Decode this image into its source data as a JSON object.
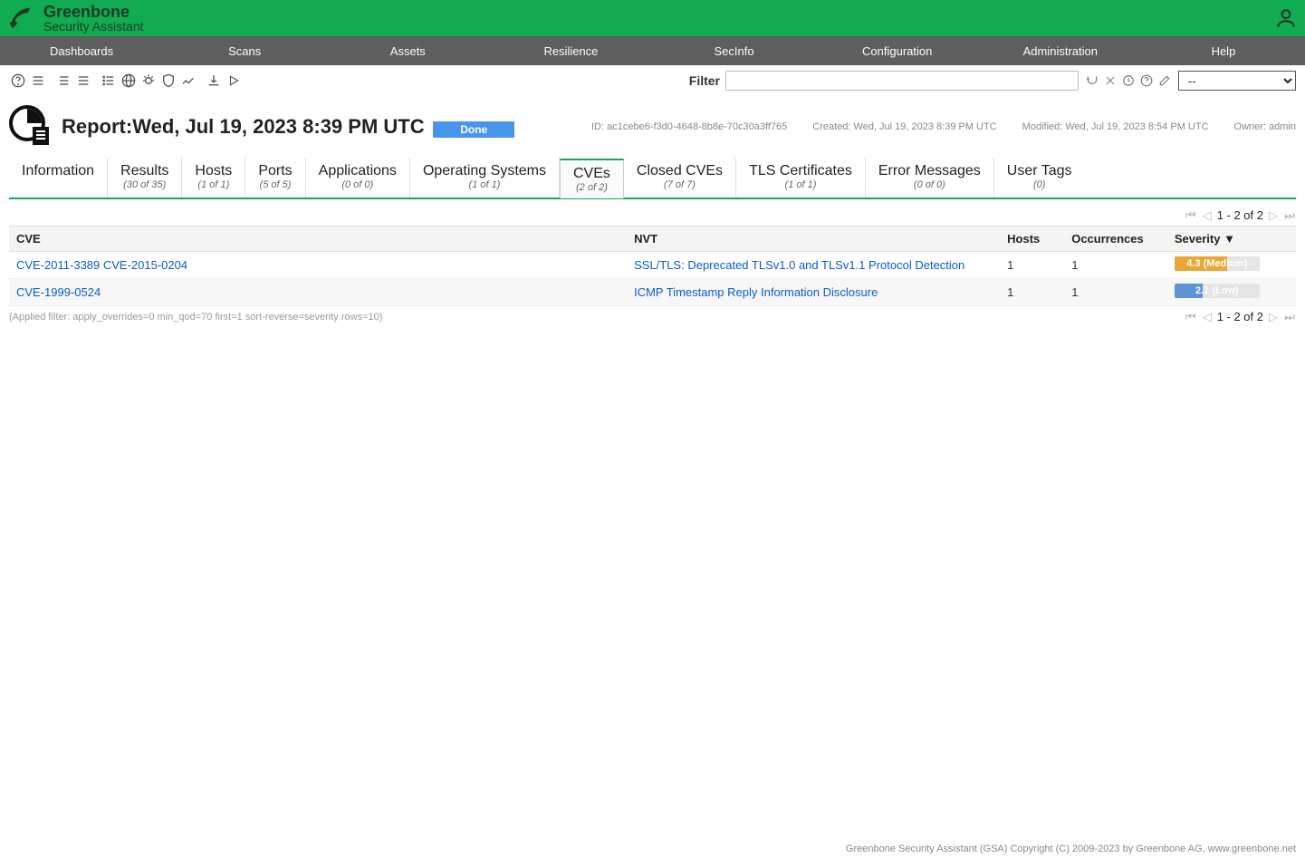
{
  "brand": {
    "line1": "Greenbone",
    "line2": "Security Assistant"
  },
  "menu": [
    "Dashboards",
    "Scans",
    "Assets",
    "Resilience",
    "SecInfo",
    "Configuration",
    "Administration",
    "Help"
  ],
  "filter": {
    "label": "Filter",
    "value": "",
    "selected": "--"
  },
  "report": {
    "title_prefix": "Report:",
    "title_date": "Wed, Jul 19, 2023 8:39 PM UTC",
    "status": "Done",
    "id_label": "ID: ac1cebe6-f3d0-4648-8b8e-70c30a3ff765",
    "created": "Created: Wed, Jul 19, 2023 8:39 PM UTC",
    "modified": "Modified: Wed, Jul 19, 2023 8:54 PM UTC",
    "owner": "Owner: admin"
  },
  "tabs": [
    {
      "label": "Information",
      "sub": ""
    },
    {
      "label": "Results",
      "sub": "(30 of 35)"
    },
    {
      "label": "Hosts",
      "sub": "(1 of 1)"
    },
    {
      "label": "Ports",
      "sub": "(5 of 5)"
    },
    {
      "label": "Applications",
      "sub": "(0 of 0)"
    },
    {
      "label": "Operating Systems",
      "sub": "(1 of 1)"
    },
    {
      "label": "CVEs",
      "sub": "(2 of 2)",
      "active": true
    },
    {
      "label": "Closed CVEs",
      "sub": "(7 of 7)"
    },
    {
      "label": "TLS Certificates",
      "sub": "(1 of 1)"
    },
    {
      "label": "Error Messages",
      "sub": "(0 of 0)"
    },
    {
      "label": "User Tags",
      "sub": "(0)"
    }
  ],
  "table": {
    "headers": {
      "cve": "CVE",
      "nvt": "NVT",
      "hosts": "Hosts",
      "occ": "Occurrences",
      "sev": "Severity ▼"
    },
    "rows": [
      {
        "cve": "CVE-2011-3389 CVE-2015-0204",
        "nvt": "SSL/TLS: Deprecated TLSv1.0 and TLSv1.1 Protocol Detection",
        "hosts": "1",
        "occ": "1",
        "sev_text": "4.3 (Medium)",
        "sev_class": "sev-med"
      },
      {
        "cve": "CVE-1999-0524",
        "nvt": "ICMP Timestamp Reply Information Disclosure",
        "hosts": "1",
        "occ": "1",
        "sev_text": "2.1 (Low)",
        "sev_class": "sev-low"
      }
    ]
  },
  "pagination": "1 - 2 of 2",
  "applied_filter": "(Applied filter: apply_overrides=0 min_qod=70 first=1 sort-reverse=severity rows=10)",
  "footer": "Greenbone Security Assistant (GSA) Copyright (C) 2009-2023 by Greenbone AG, www.greenbone.net"
}
